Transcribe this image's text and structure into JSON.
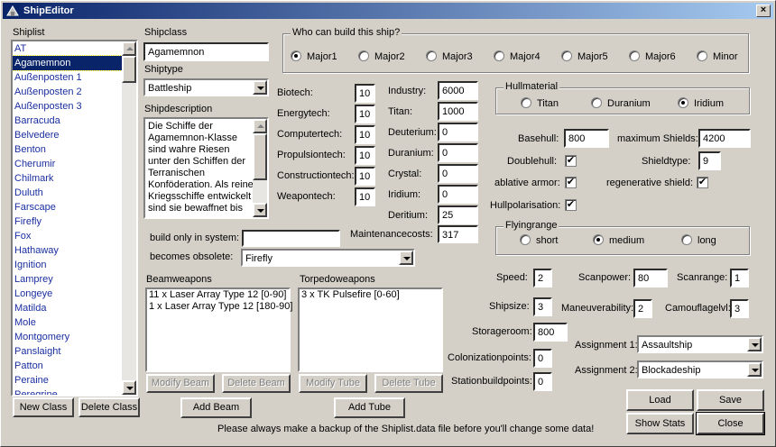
{
  "window": {
    "title": "ShipEditor",
    "close": "×"
  },
  "shiplist": {
    "label": "Shiplist",
    "items": [
      "AT",
      "Agamemnon",
      "Außenposten 1",
      "Außenposten 2",
      "Außenposten 3",
      "Barracuda",
      "Belvedere",
      "Benton",
      "Cherumir",
      "Chilmark",
      "Duluth",
      "Farscape",
      "Firefly",
      "Fox",
      "Hathaway",
      "Ignition",
      "Lamprey",
      "Longeye",
      "Matilda",
      "Mole",
      "Montgomery",
      "Panslaight",
      "Patton",
      "Peraine",
      "Peregrine"
    ],
    "selected_index": 1,
    "new_class": "New Class",
    "delete_class": "Delete Class"
  },
  "shipclass": {
    "label": "Shipclass",
    "value": "Agamemnon"
  },
  "shiptype": {
    "label": "Shiptype",
    "value": "Battleship"
  },
  "shipdescription": {
    "label": "Shipdescription",
    "text": "Die Schiffe der Agamemnon-Klasse sind wahre Riesen unter den Schiffen der Terranischen Konföderation. Als reine Kriegsschiffe entwickelt sind sie bewaffnet bis an"
  },
  "builders": {
    "title": "Who can build this ship?",
    "options": [
      "Major1",
      "Major2",
      "Major3",
      "Major4",
      "Major5",
      "Major6",
      "Minor"
    ],
    "selected": "Major1"
  },
  "techs": [
    {
      "label": "Biotech:",
      "value": "10"
    },
    {
      "label": "Energytech:",
      "value": "10"
    },
    {
      "label": "Computertech:",
      "value": "10"
    },
    {
      "label": "Propulsiontech:",
      "value": "10"
    },
    {
      "label": "Constructiontech:",
      "value": "10"
    },
    {
      "label": "Weapontech:",
      "value": "10"
    }
  ],
  "resources": [
    {
      "label": "Industry:",
      "value": "6000"
    },
    {
      "label": "Titan:",
      "value": "1000"
    },
    {
      "label": "Deuterium:",
      "value": "0"
    },
    {
      "label": "Duranium:",
      "value": "0"
    },
    {
      "label": "Crystal:",
      "value": "0"
    },
    {
      "label": "Iridium:",
      "value": "0"
    },
    {
      "label": "Deritium:",
      "value": "25"
    }
  ],
  "maintenance": {
    "label": "Maintenancecosts:",
    "value": "317"
  },
  "build_only": {
    "label": "build only in system:",
    "value": ""
  },
  "obsolete": {
    "label": "becomes obsolete:",
    "value": "Firefly"
  },
  "hullmaterial": {
    "title": "Hullmaterial",
    "options": [
      "Titan",
      "Duranium",
      "Iridium"
    ],
    "selected": "Iridium"
  },
  "hull": {
    "basehull_label": "Basehull:",
    "basehull": "800",
    "maxshields_label": "maximum Shields:",
    "maxshields": "4200",
    "doublehull_label": "Doublehull:",
    "doublehull": "✔",
    "shieldtype_label": "Shieldtype:",
    "shieldtype": "9",
    "ablative_label": "ablative armor:",
    "ablative": "✔",
    "regen_label": "regenerative shield:",
    "regen": "✔",
    "polar_label": "Hullpolarisation:",
    "polar": "✔"
  },
  "flyingrange": {
    "title": "Flyingrange",
    "options": [
      "short",
      "medium",
      "long"
    ],
    "selected": "medium"
  },
  "stats": {
    "speed_label": "Speed:",
    "speed": "2",
    "scanpower_label": "Scanpower:",
    "scanpower": "80",
    "scanrange_label": "Scanrange:",
    "scanrange": "1",
    "shipsize_label": "Shipsize:",
    "shipsize": "3",
    "maneuver_label": "Maneuverability:",
    "maneuver": "2",
    "camo_label": "Camouflagelvl:",
    "camo": "3",
    "storage_label": "Storageroom:",
    "storage": "800",
    "colon_label": "Colonizationpoints:",
    "colon": "0",
    "station_label": "Stationbuildpoints:",
    "station": "0"
  },
  "assignments": {
    "a1_label": "Assignment 1:",
    "a1": "Assaultship",
    "a2_label": "Assignment 2:",
    "a2": "Blockadeship"
  },
  "beam": {
    "label": "Beamweapons",
    "items": [
      "11 x Laser Array Type 12 [0-90]",
      "1 x Laser Array Type 12 [180-90]"
    ],
    "modify": "Modify Beam",
    "delete": "Delete Beam",
    "add": "Add Beam"
  },
  "torpedo": {
    "label": "Torpedoweapons",
    "items": [
      "3 x TK Pulsefire [0-60]"
    ],
    "modify": "Modify Tube",
    "delete": "Delete Tube",
    "add": "Add Tube"
  },
  "actions": {
    "load": "Load",
    "save": "Save",
    "stats": "Show Stats",
    "close": "Close"
  },
  "footer": "Please always make a backup of the Shiplist.data file before you'll change some data!",
  "colors": {
    "title_start": "#0a246a",
    "title_end": "#a6caf0",
    "face": "#d4d0c8",
    "list_text": "#1a2ea0"
  }
}
